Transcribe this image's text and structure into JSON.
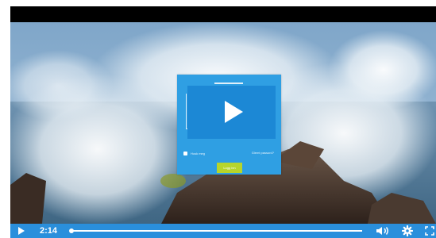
{
  "player": {
    "current_time": "2:14",
    "progress_fraction": 0.0,
    "colors": {
      "controls_bar": "#2a8fdc",
      "card_background": "#2f9fe3",
      "play_overlay": "#1c88d5",
      "login_button": "#b6d52c"
    },
    "icons": {
      "play": "play-icon",
      "volume": "volume-icon",
      "settings": "gear-icon",
      "fullscreen": "fullscreen-icon"
    }
  },
  "login_form": {
    "remember_label": "Husk meg",
    "forgot_password": "Glemt passord?",
    "login_button": "Logg inn"
  }
}
